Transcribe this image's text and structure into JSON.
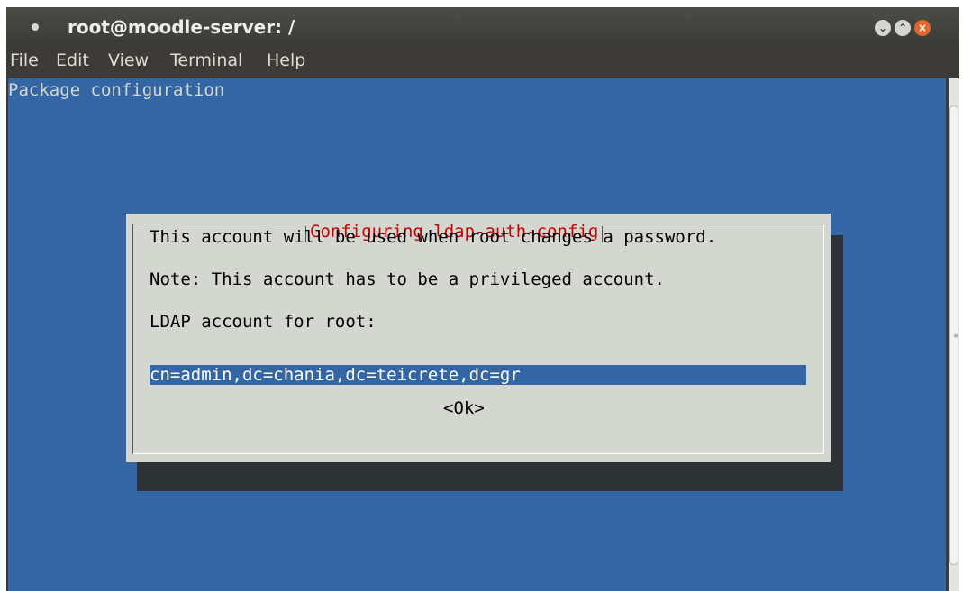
{
  "window": {
    "title": "root@moodle-server: /"
  },
  "menu": [
    "File",
    "Edit",
    "View",
    "Terminal",
    "Help"
  ],
  "terminal": {
    "header": "Package configuration"
  },
  "dialog": {
    "title": "Configuring ldap-auth-config",
    "line1": "This account will be used when root changes a password.",
    "line2": "Note: This account has to be a privileged account.",
    "prompt": "LDAP account for root:",
    "input_value": "cn=admin,dc=chania,dc=teicrete,dc=gr",
    "ok_label": "<Ok>"
  },
  "colors": {
    "terminal_bg": "#3465a4",
    "dialog_bg": "#d3d7cf",
    "dialog_title": "#cc0000",
    "close_button": "#e2662d"
  }
}
